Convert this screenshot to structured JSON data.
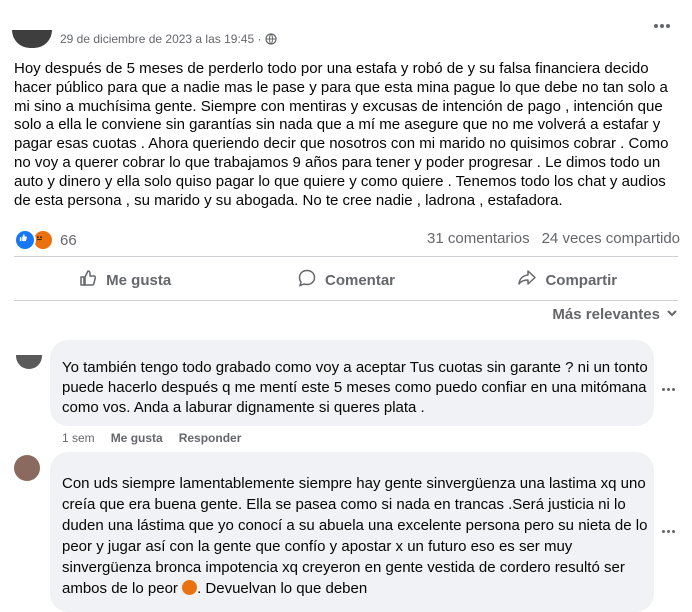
{
  "post": {
    "timestamp": "29 de diciembre de 2023 a las 19:45 ·",
    "body": "Hoy después de 5 meses de perderlo todo por una estafa y robó de              y su falsa financiera decido hacer público para que a nadie mas le pase y para  que esta mina pague lo que debe no tan solo a mi sino a muchísima gente. Siempre con mentiras y excusas de intención de pago , intención que solo a ella le conviene sin garantías sin nada que a mí me asegure que no me volverá a estafar y pagar esas cuotas . Ahora queriendo decir que nosotros con mi marido no quisimos cobrar . Como no voy a querer cobrar lo que trabajamos 9 años para tener y poder progresar . Le dimos todo un auto y dinero y ella solo quiso pagar lo que quiere y como quiere . Tenemos todo los chat y audios de esta persona , su marido y su abogada. No te cree nadie       , ladrona , estafadora."
  },
  "stats": {
    "reaction_count": "66",
    "comments": "31 comentarios",
    "shares": "24 veces compartido"
  },
  "actions": {
    "like": "Me gusta",
    "comment": "Comentar",
    "share": "Compartir"
  },
  "sort_label": "Más relevantes",
  "comments": [
    {
      "text": "Yo también tengo todo grabado           como voy a aceptar Tus cuotas sin garante ? ni un tonto puede hacerlo después q me mentí este 5 meses como puedo confiar en una mitómana como vos. Anda a laburar dignamente si queres plata .",
      "time": "1 sem",
      "like": "Me gusta",
      "reply": "Responder"
    },
    {
      "text_main": "Con uds siempre lamentablemente siempre hay gente sinvergüenza una lastima xq uno creía que era buena gente. Ella se pasea como si nada en trancas .Será justicia ni lo duden una lástima que yo conocí a su abuela una excelente persona pero su nieta de lo peor y jugar así con la gente que confío y apostar x un futuro eso es ser muy sinvergüenza bronca impotencia xq creyeron en gente vestida de cordero resultó ser ambos de lo peor",
      "text_tail": ". Devuelvan lo que deben"
    }
  ],
  "colors": {
    "brand_blue": "#1877f2",
    "angry_orange": "#e9710f",
    "secondary_text": "#65676b",
    "bubble_bg": "#f0f2f5"
  },
  "icons": [
    "globe-icon",
    "more-options-icon",
    "like-reaction-icon",
    "angry-reaction-icon",
    "thumbs-up-icon",
    "comment-bubble-icon",
    "share-arrow-icon",
    "chevron-down-icon",
    "angry-emoji-icon"
  ]
}
